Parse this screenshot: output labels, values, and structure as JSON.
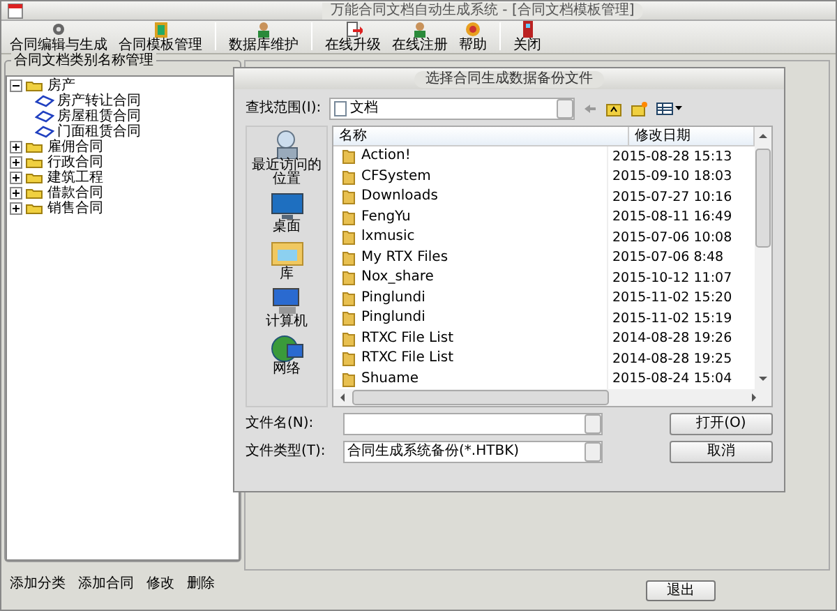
{
  "window": {
    "title": "万能合同文档自动生成系统 - [合同文档模板管理]"
  },
  "toolbar": [
    {
      "label": "合同编辑与生成",
      "separator_before": false
    },
    {
      "label": "合同模板管理",
      "separator_before": false
    },
    {
      "label": "数据库维护",
      "separator_before": true
    },
    {
      "label": "在线升级",
      "separator_before": true
    },
    {
      "label": "在线注册",
      "separator_before": false
    },
    {
      "label": "帮助",
      "separator_before": false
    },
    {
      "label": "关闭",
      "separator_before": true
    }
  ],
  "tree": {
    "title": "合同文档类别名称管理",
    "items": [
      {
        "label": "房产",
        "expanded": true,
        "children": [
          {
            "label": "房产转让合同"
          },
          {
            "label": "房屋租赁合同"
          },
          {
            "label": "门面租赁合同"
          }
        ]
      },
      {
        "label": "雇佣合同",
        "expanded": false
      },
      {
        "label": "行政合同",
        "expanded": false
      },
      {
        "label": "建筑工程",
        "expanded": false
      },
      {
        "label": "借款合同",
        "expanded": false
      },
      {
        "label": "销售合同",
        "expanded": false
      }
    ]
  },
  "tree_actions": [
    "添加分类",
    "添加合同",
    "修改",
    "删除"
  ],
  "exit_button": "退出",
  "dialog": {
    "title": "选择合同生成数据备份文件",
    "look_in_label": "查找范围(I):",
    "look_in": "文档",
    "places": [
      {
        "label": "最近访问的位置"
      },
      {
        "label": "桌面"
      },
      {
        "label": "库"
      },
      {
        "label": "计算机"
      },
      {
        "label": "网络"
      }
    ],
    "columns": [
      "名称",
      "修改日期"
    ],
    "files": [
      {
        "name": "Action!",
        "date": "2015-08-28 15:13"
      },
      {
        "name": "CFSystem",
        "date": "2015-09-10 18:03"
      },
      {
        "name": "Downloads",
        "date": "2015-07-27 10:16"
      },
      {
        "name": "FengYu",
        "date": "2015-08-11 16:49"
      },
      {
        "name": "lxmusic",
        "date": "2015-07-06 10:08"
      },
      {
        "name": "My RTX Files",
        "date": "2015-07-06 8:48"
      },
      {
        "name": "Nox_share",
        "date": "2015-10-12 11:07"
      },
      {
        "name": "Pinglundi",
        "date": "2015-11-02 15:20"
      },
      {
        "name": "Pinglundi",
        "date": "2015-11-02 15:19"
      },
      {
        "name": "RTXC File List",
        "date": "2014-08-28 19:26"
      },
      {
        "name": "RTXC File List",
        "date": "2014-08-28 19:25"
      },
      {
        "name": "Shuame",
        "date": "2015-08-24 15:04"
      }
    ],
    "filename_label": "文件名(N):",
    "filetype_label": "文件类型(T):",
    "filetype": "合同生成系统备份(*.HTBK)",
    "buttons": [
      "打开(O)",
      "取消"
    ]
  }
}
